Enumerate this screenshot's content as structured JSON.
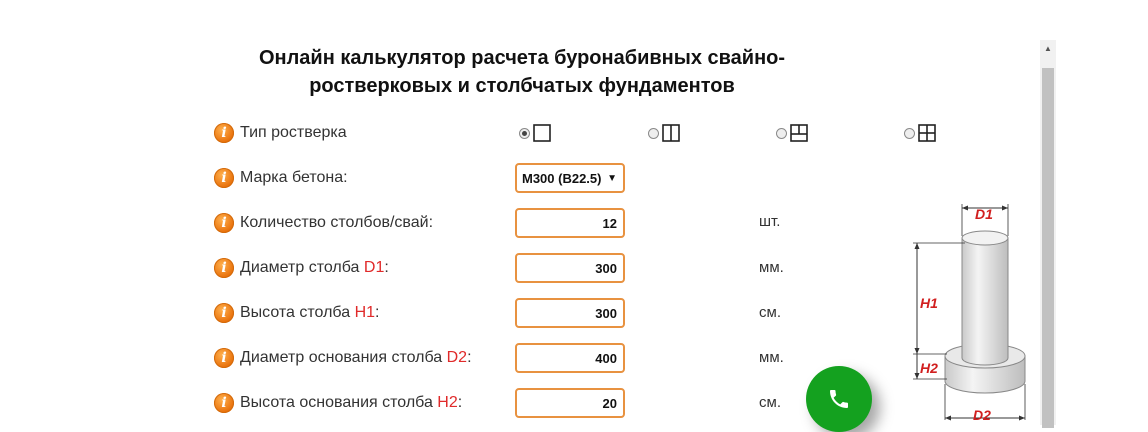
{
  "title": "Онлайн калькулятор расчета буронабивных свайно-ростверковых и столбчатых фундаментов",
  "rows": [
    {
      "label": "Тип ростверка",
      "hl": ""
    },
    {
      "label": "Марка бетона:",
      "hl": ""
    },
    {
      "label": "Количество столбов/свай:",
      "hl": ""
    },
    {
      "label": "Диаметр столба ",
      "hl": "D1",
      "suffix": ":"
    },
    {
      "label": "Высота столба ",
      "hl": "H1",
      "suffix": ":"
    },
    {
      "label": "Диаметр основания столба ",
      "hl": "D2",
      "suffix": ":"
    },
    {
      "label": "Высота основания столба ",
      "hl": "H2",
      "suffix": ":"
    }
  ],
  "concrete_grade": {
    "selected": "М300 (В22.5)"
  },
  "fields": {
    "count": "12",
    "d1": "300",
    "h1": "300",
    "d2": "400",
    "h2": "20"
  },
  "units": {
    "count": "шт.",
    "d1": "мм.",
    "h1": "см.",
    "d2": "мм.",
    "h2": "см."
  },
  "grillage_options": [
    {
      "name": "single",
      "checked": true
    },
    {
      "name": "double",
      "checked": false
    },
    {
      "name": "t-shape",
      "checked": false
    },
    {
      "name": "cross",
      "checked": false
    }
  ],
  "diagram_labels": {
    "d1": "D1",
    "h1": "H1",
    "h2": "H2",
    "d2": "D2"
  },
  "icons": {
    "info": "info-icon",
    "call": "phone-icon"
  },
  "colors": {
    "accent": "#e89240",
    "highlight": "#e02a2a",
    "call": "#14a11f"
  }
}
